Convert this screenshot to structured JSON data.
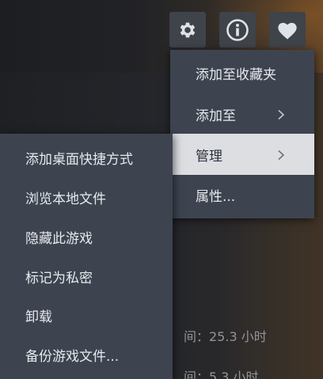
{
  "toolbar": {
    "icons": [
      "gear-icon",
      "info-icon",
      "heart-icon"
    ],
    "colors": {
      "button_bg": "#3f434a",
      "icon": "#dfe2e6"
    }
  },
  "context_menu": {
    "items": [
      {
        "label": "添加至收藏夹",
        "has_submenu": false,
        "highlighted": false
      },
      {
        "label": "添加至",
        "has_submenu": true,
        "highlighted": false
      },
      {
        "label": "管理",
        "has_submenu": true,
        "highlighted": true
      },
      {
        "label": "属性...",
        "has_submenu": false,
        "highlighted": false
      }
    ],
    "colors": {
      "bg": "#3d4450",
      "text": "#e7e9ec",
      "highlight_bg": "#dcdee2",
      "highlight_text": "#2d323b"
    }
  },
  "manage_submenu": {
    "items": [
      {
        "label": "添加桌面快捷方式"
      },
      {
        "label": "浏览本地文件"
      },
      {
        "label": "隐藏此游戏"
      },
      {
        "label": "标记为私密"
      },
      {
        "label": "卸载"
      },
      {
        "label": "备份游戏文件..."
      }
    ]
  },
  "background": {
    "stat_1": "间：25.3 小时",
    "stat_2": "间：5.3 小时"
  }
}
